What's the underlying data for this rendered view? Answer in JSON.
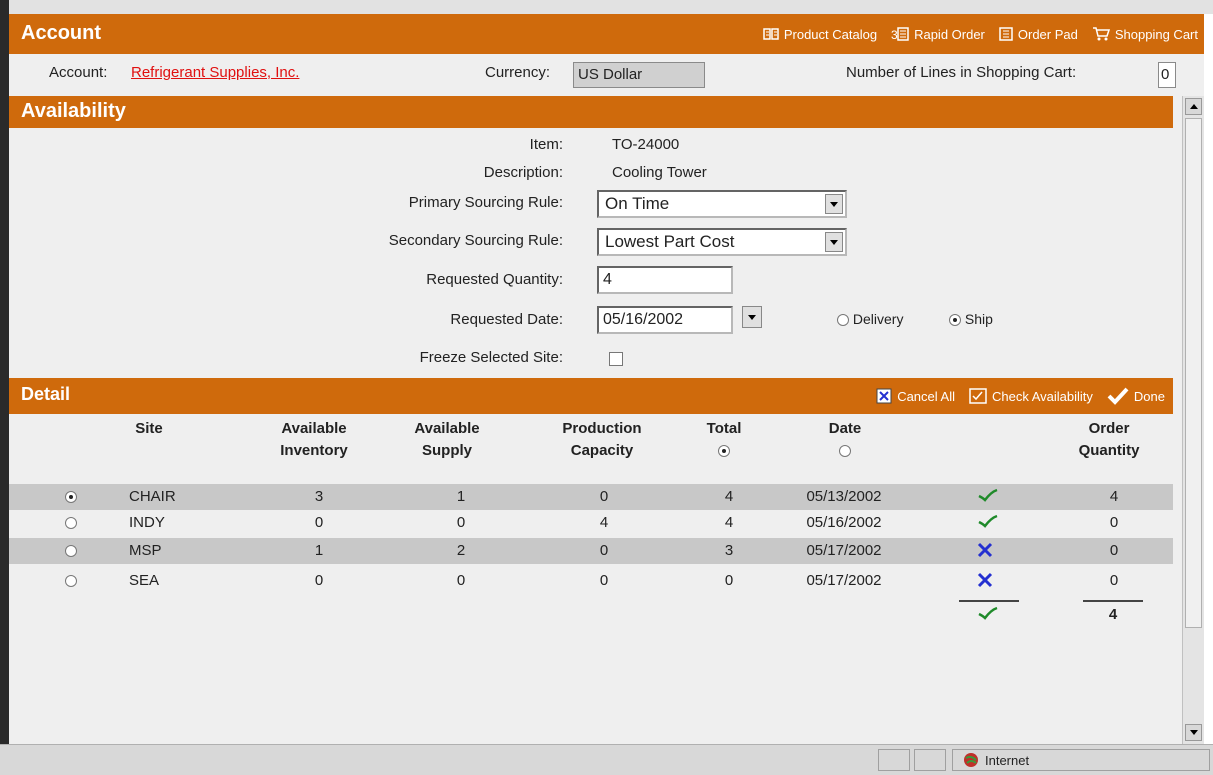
{
  "header": {
    "title": "Account",
    "nav": [
      {
        "label": "Product Catalog",
        "icon": "book-icon"
      },
      {
        "label": "Rapid Order",
        "icon": "list-icon"
      },
      {
        "label": "Order Pad",
        "icon": "notepad-icon"
      },
      {
        "label": "Shopping Cart",
        "icon": "cart-icon"
      }
    ]
  },
  "account_row": {
    "account_label": "Account:",
    "account_link": "Refrigerant Supplies, Inc.",
    "currency_label": "Currency:",
    "currency_value": "US Dollar",
    "lines_label": "Number of Lines in Shopping Cart:",
    "lines_value": "0"
  },
  "availability": {
    "title": "Availability",
    "item_label": "Item:",
    "item_value": "TO-24000",
    "description_label": "Description:",
    "description_value": "Cooling Tower",
    "primary_label": "Primary Sourcing Rule:",
    "primary_value": "On Time",
    "secondary_label": "Secondary Sourcing Rule:",
    "secondary_value": "Lowest Part Cost",
    "quantity_label": "Requested Quantity:",
    "quantity_value": "4",
    "date_label": "Requested Date:",
    "date_value": "05/16/2002",
    "delivery_label": "Delivery",
    "ship_label": "Ship",
    "ship_selected": true,
    "freeze_label": "Freeze Selected Site:",
    "freeze_checked": false
  },
  "detail": {
    "title": "Detail",
    "actions": [
      {
        "label": "Cancel All",
        "icon": "cancel-icon"
      },
      {
        "label": "Check Availability",
        "icon": "check-availability-icon"
      },
      {
        "label": "Done",
        "icon": "done-checkmark-icon"
      }
    ],
    "columns": {
      "site": "Site",
      "avail_inv_1": "Available",
      "avail_inv_2": "Inventory",
      "avail_sup_1": "Available",
      "avail_sup_2": "Supply",
      "prod_1": "Production",
      "prod_2": "Capacity",
      "total": "Total",
      "date": "Date",
      "order_1": "Order",
      "order_2": "Quantity"
    },
    "sort_total_selected": true,
    "sort_date_selected": false,
    "rows": [
      {
        "selected": true,
        "site": "CHAIR",
        "inventory": "3",
        "supply": "1",
        "capacity": "0",
        "total": "4",
        "date": "05/13/2002",
        "status": "check-icon",
        "qty": "4"
      },
      {
        "selected": false,
        "site": "INDY",
        "inventory": "0",
        "supply": "0",
        "capacity": "4",
        "total": "4",
        "date": "05/16/2002",
        "status": "check-icon",
        "qty": "0"
      },
      {
        "selected": false,
        "site": "MSP",
        "inventory": "1",
        "supply": "2",
        "capacity": "0",
        "total": "3",
        "date": "05/17/2002",
        "status": "x-icon",
        "qty": "0"
      },
      {
        "selected": false,
        "site": "SEA",
        "inventory": "0",
        "supply": "0",
        "capacity": "0",
        "total": "0",
        "date": "05/17/2002",
        "status": "x-icon",
        "qty": "0"
      }
    ],
    "total_qty": "4",
    "total_status": "check-icon"
  },
  "status_bar": {
    "zone": "Internet"
  },
  "colors": {
    "accent": "#cf6a0c",
    "check": "#1f8a2a",
    "x_mark": "#2430d0",
    "link": "#e01010"
  }
}
